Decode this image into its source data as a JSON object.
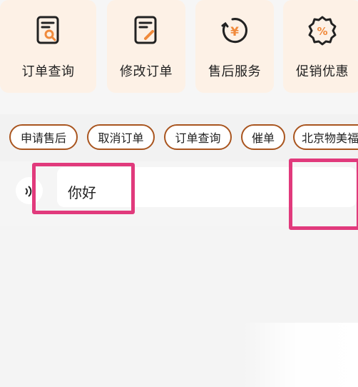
{
  "quick_actions": [
    {
      "label": "订单查询",
      "icon": "order-search-icon"
    },
    {
      "label": "修改订单",
      "icon": "edit-order-icon"
    },
    {
      "label": "售后服务",
      "icon": "after-sales-yen-icon"
    },
    {
      "label": "促销优惠",
      "icon": "promotion-percent-icon"
    }
  ],
  "chips": [
    "申请售后",
    "取消订单",
    "订单查询",
    "催单",
    "北京物美福"
  ],
  "input": {
    "value": "你好"
  },
  "colors": {
    "card_bg": "#fdf1e6",
    "chip_border": "#a9551f",
    "highlight": "#e13a7c",
    "icon_accent": "#f08a3c"
  }
}
